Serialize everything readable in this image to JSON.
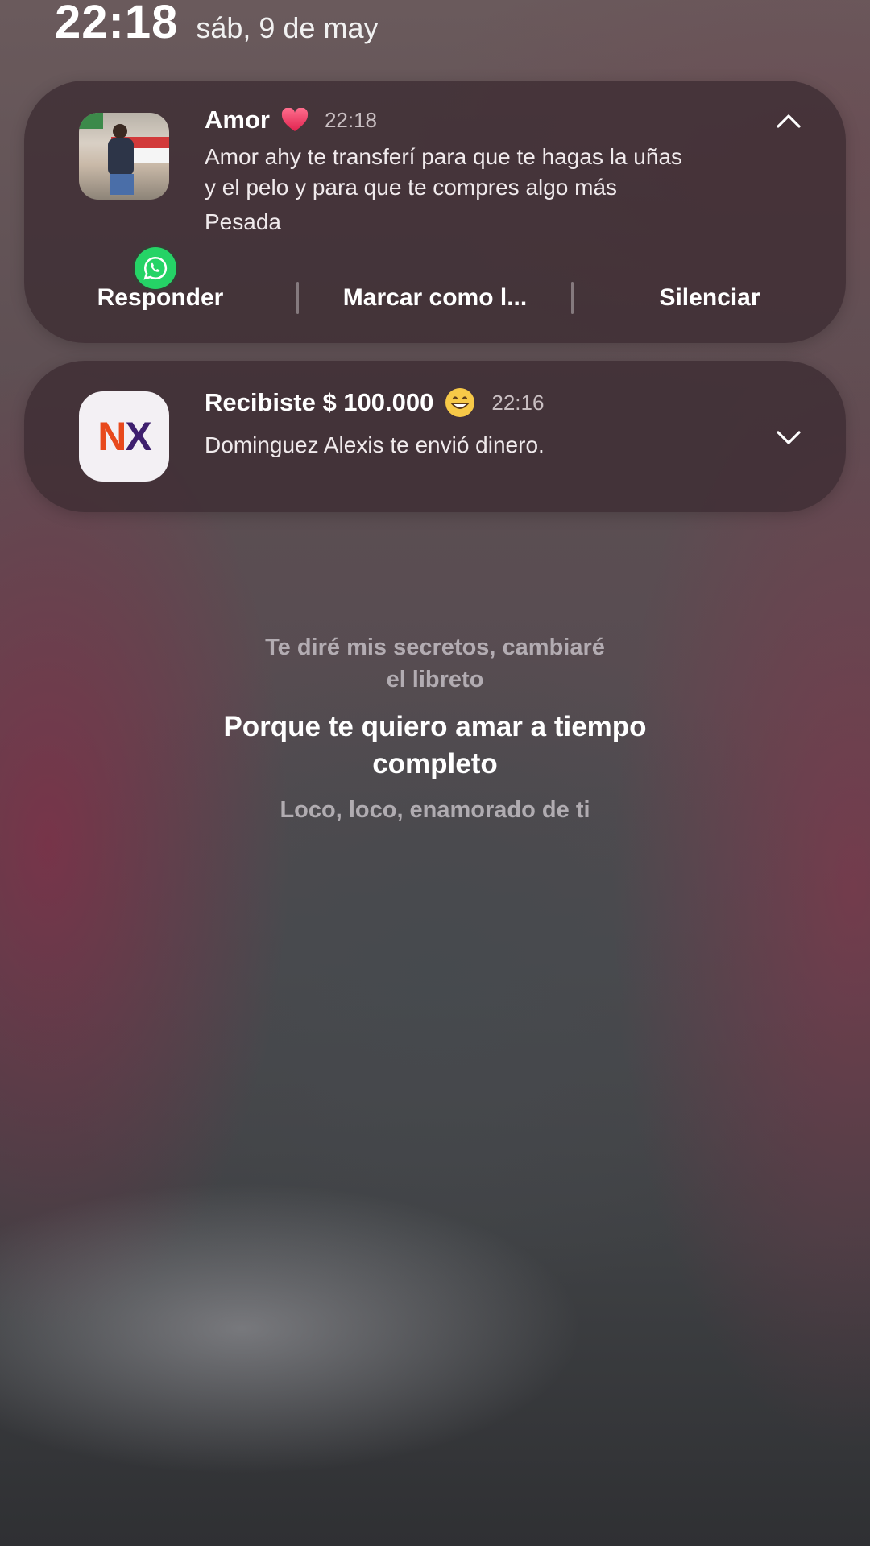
{
  "status": {
    "time": "22:18",
    "date": "sáb, 9 de may"
  },
  "notifications": [
    {
      "app_icon": "whatsapp-icon",
      "title": "Amor",
      "title_emoji": "red-heart-icon",
      "time": "22:18",
      "message_lines": [
        "Amor ahy te transferí para que te hagas la uñas",
        "y el pelo y para que te compres algo más"
      ],
      "subtext": "Pesada",
      "expanded": true,
      "actions": [
        "Responder",
        "Marcar como l...",
        "Silenciar"
      ]
    },
    {
      "app_icon": "nx-app-icon",
      "app_icon_text": [
        "N",
        "X"
      ],
      "title": "Recibiste $ 100.000",
      "title_emoji": "grinning-face-icon",
      "time": "22:16",
      "message": "Dominguez Alexis te envió dinero.",
      "expanded": false
    }
  ],
  "lyrics": {
    "previous": [
      "Te diré mis secretos, cambiaré",
      "el libreto"
    ],
    "current": [
      "Porque te quiero amar a tiempo",
      "completo"
    ],
    "next": [
      "Loco, loco, enamorado de ti"
    ]
  },
  "colors": {
    "whatsapp_green": "#25d366",
    "heart_red": "#e8345a",
    "nx_orange": "#e8491c",
    "nx_purple": "#3e1f6e"
  }
}
